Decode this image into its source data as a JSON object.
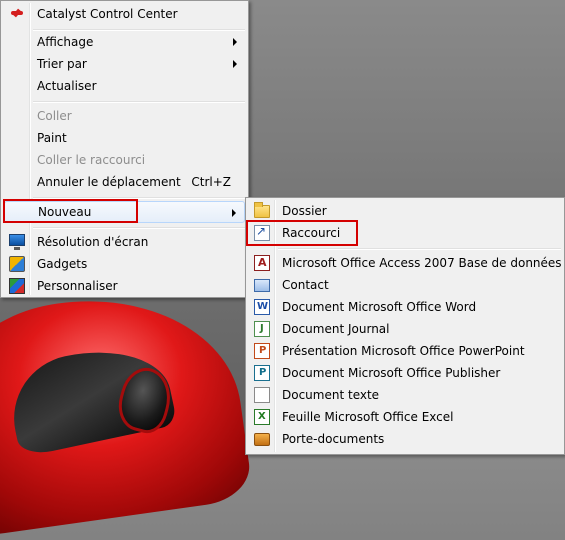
{
  "main_menu": {
    "items": [
      {
        "label": "Catalyst Control Center",
        "icon": "catalyst-icon"
      },
      {
        "label": "Affichage",
        "has_submenu": true
      },
      {
        "label": "Trier par",
        "has_submenu": true
      },
      {
        "label": "Actualiser"
      },
      {
        "label": "Coller",
        "disabled": true
      },
      {
        "label": "Paint"
      },
      {
        "label": "Coller le raccourci",
        "disabled": true
      },
      {
        "label": "Annuler le déplacement",
        "shortcut": "Ctrl+Z"
      },
      {
        "label": "Nouveau",
        "has_submenu": true,
        "highlighted": true
      },
      {
        "label": "Résolution d'écran",
        "icon": "monitor-icon"
      },
      {
        "label": "Gadgets",
        "icon": "gadgets-icon"
      },
      {
        "label": "Personnaliser",
        "icon": "personalize-icon"
      }
    ]
  },
  "sub_menu": {
    "items": [
      {
        "label": "Dossier",
        "icon": "folder-icon"
      },
      {
        "label": "Raccourci",
        "icon": "shortcut-icon"
      },
      {
        "label": "Microsoft Office Access 2007 Base de données",
        "icon": "access-icon"
      },
      {
        "label": "Contact",
        "icon": "contact-icon"
      },
      {
        "label": "Document Microsoft Office Word",
        "icon": "word-icon"
      },
      {
        "label": "Document Journal",
        "icon": "journal-icon"
      },
      {
        "label": "Présentation Microsoft Office PowerPoint",
        "icon": "powerpoint-icon"
      },
      {
        "label": "Document Microsoft Office Publisher",
        "icon": "publisher-icon"
      },
      {
        "label": "Document texte",
        "icon": "text-document-icon"
      },
      {
        "label": "Feuille Microsoft Office Excel",
        "icon": "excel-icon"
      },
      {
        "label": "Porte-documents",
        "icon": "briefcase-icon"
      }
    ]
  },
  "colors": {
    "menu_bg": "#f0f0f0",
    "highlight_box": "#d40000",
    "disabled_text": "#8d8d8d"
  }
}
